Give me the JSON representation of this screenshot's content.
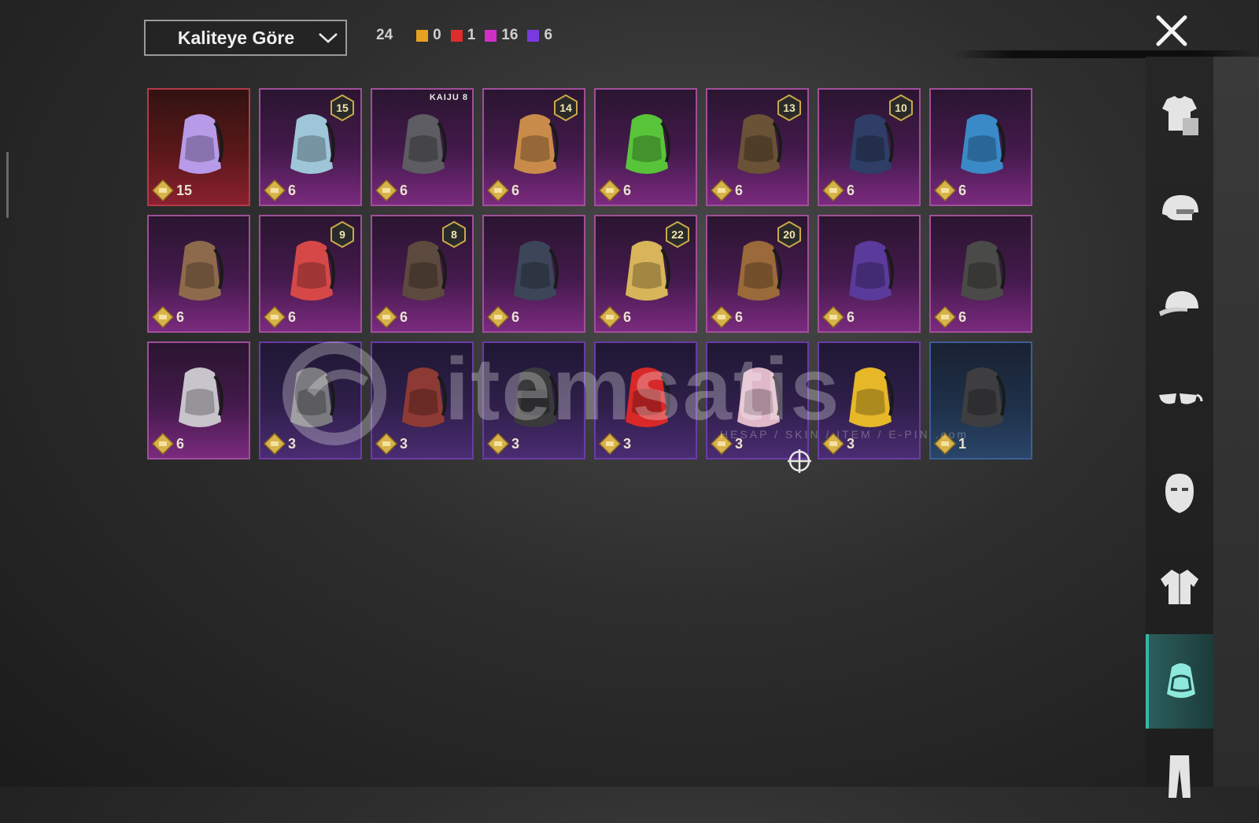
{
  "sort": {
    "label": "Kaliteye Göre"
  },
  "counts": {
    "total": "24",
    "tiers": [
      {
        "color": "#e8a020",
        "value": "0"
      },
      {
        "color": "#e02c2c",
        "value": "1"
      },
      {
        "color": "#d030c8",
        "value": "16"
      },
      {
        "color": "#7a3ae0",
        "value": "6"
      }
    ]
  },
  "items": [
    {
      "price": "15",
      "tier": "red",
      "pack_color": "#b79ae8",
      "badge": ""
    },
    {
      "price": "6",
      "tier": "pink",
      "pack_color": "#9ec6d8",
      "badge": "15"
    },
    {
      "price": "6",
      "tier": "pink",
      "pack_color": "#5c5c62",
      "badge": "",
      "brand": "KAIJU 8"
    },
    {
      "price": "6",
      "tier": "pink",
      "pack_color": "#c98b4a",
      "badge": "14"
    },
    {
      "price": "6",
      "tier": "pink",
      "pack_color": "#58c43a",
      "badge": ""
    },
    {
      "price": "6",
      "tier": "pink",
      "pack_color": "#6a5236",
      "badge": "13"
    },
    {
      "price": "6",
      "tier": "pink",
      "pack_color": "#2e3e66",
      "badge": "10"
    },
    {
      "price": "6",
      "tier": "pink",
      "pack_color": "#3a8ac8",
      "badge": ""
    },
    {
      "price": "6",
      "tier": "pink",
      "pack_color": "#8e6a4c",
      "badge": ""
    },
    {
      "price": "6",
      "tier": "pink",
      "pack_color": "#d64848",
      "badge": "9"
    },
    {
      "price": "6",
      "tier": "pink",
      "pack_color": "#5c4a3e",
      "badge": "8"
    },
    {
      "price": "6",
      "tier": "pink",
      "pack_color": "#3c4658",
      "badge": ""
    },
    {
      "price": "6",
      "tier": "pink",
      "pack_color": "#d8b45a",
      "badge": "22"
    },
    {
      "price": "6",
      "tier": "pink",
      "pack_color": "#9a6a3a",
      "badge": "20"
    },
    {
      "price": "6",
      "tier": "pink",
      "pack_color": "#5a3a9a",
      "badge": ""
    },
    {
      "price": "6",
      "tier": "pink",
      "pack_color": "#4a4a48",
      "badge": ""
    },
    {
      "price": "6",
      "tier": "pink",
      "pack_color": "#c8c4cc",
      "badge": ""
    },
    {
      "price": "3",
      "tier": "purple",
      "pack_color": "#7a7a80",
      "badge": ""
    },
    {
      "price": "3",
      "tier": "purple",
      "pack_color": "#8e3a34",
      "badge": ""
    },
    {
      "price": "3",
      "tier": "purple",
      "pack_color": "#3a3a3c",
      "badge": ""
    },
    {
      "price": "3",
      "tier": "purple",
      "pack_color": "#d82828",
      "badge": ""
    },
    {
      "price": "3",
      "tier": "purple",
      "pack_color": "#e0b8c8",
      "badge": ""
    },
    {
      "price": "3",
      "tier": "purple",
      "pack_color": "#e6b828",
      "badge": ""
    },
    {
      "price": "1",
      "tier": "blue",
      "pack_color": "#3e3e40",
      "badge": ""
    }
  ],
  "watermark": {
    "text": "itemsatis",
    "sub": "HESAP / SKIN / ITEM / E-PIN .com"
  },
  "sidebar": {
    "items": [
      {
        "icon": "outfit-icon"
      },
      {
        "icon": "helmet-icon"
      },
      {
        "icon": "cap-icon"
      },
      {
        "icon": "glasses-icon"
      },
      {
        "icon": "mask-icon"
      },
      {
        "icon": "jacket-icon"
      },
      {
        "icon": "backpack-icon"
      },
      {
        "icon": "pants-icon"
      }
    ],
    "active": "backpack-icon"
  }
}
